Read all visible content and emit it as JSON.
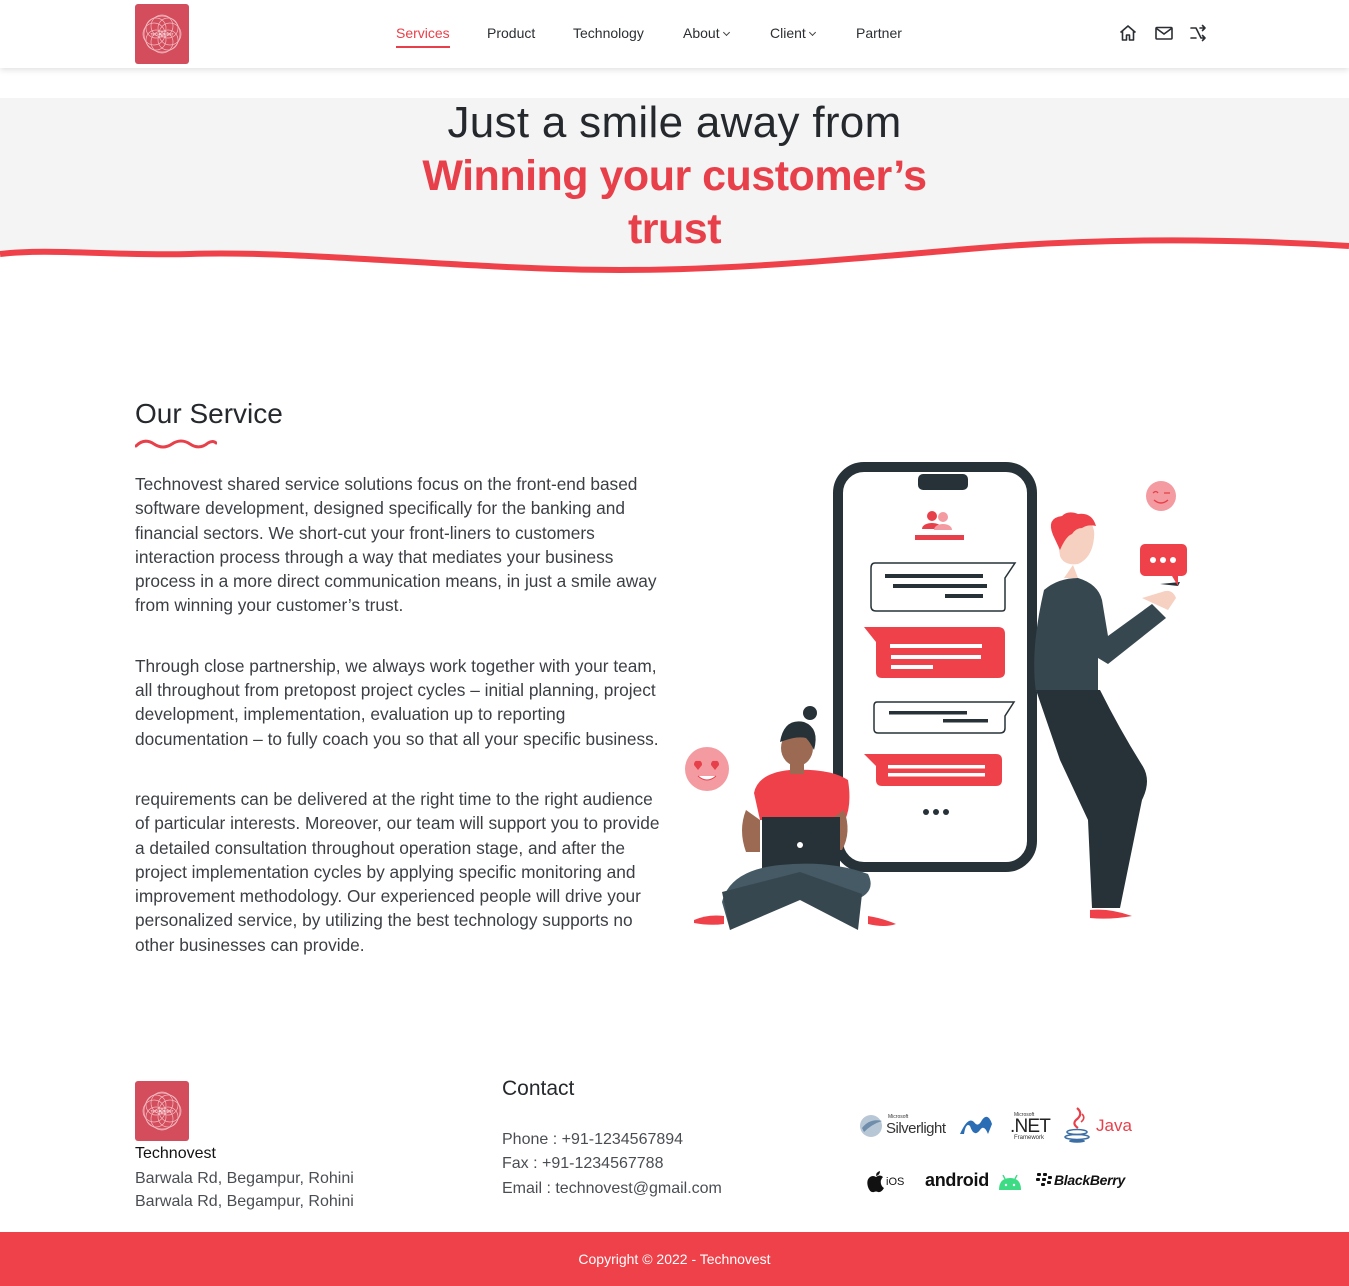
{
  "brand": {
    "logo_text": "TECHNOVEST",
    "name": "Technovest"
  },
  "nav": {
    "items": [
      {
        "label": "Services",
        "active": true
      },
      {
        "label": "Product"
      },
      {
        "label": "Technology"
      },
      {
        "label": "About",
        "dropdown": true
      },
      {
        "label": "Client",
        "dropdown": true
      },
      {
        "label": "Partner"
      }
    ],
    "icons": [
      "home-icon",
      "mail-icon",
      "shuffle-icon"
    ]
  },
  "hero": {
    "line1": "Just a smile away from",
    "line2a": "Winning your customer’s",
    "line2b": "trust"
  },
  "service": {
    "title": "Our Service",
    "paragraphs": [
      "Technovest shared service solutions focus on the front-end based software development, designed specifically for the banking and financial sectors. We short-cut your front-liners to customers interaction process through a way that mediates your business process in a more direct communication means, in just a smile away from winning your customer’s trust.",
      "Through close partnership, we always work together with your team, all throughout from pretopost project cycles – initial planning, project development, implementation, evaluation up to reporting documentation – to fully coach you so that all your specific business.",
      "requirements can be delivered at the right time to the right audience of particular interests. Moreover, our team will support you to provide a detailed consultation throughout operation stage, and after the project implementation cycles by applying specific monitoring and improvement methodology. Our experienced people will drive your personalized service, by utilizing the best technology supports no other businesses can provide."
    ]
  },
  "footer": {
    "brand": "Technovest",
    "address1": "Barwala Rd, Begampur, Rohini",
    "address2": "Barwala Rd, Begampur, Rohini",
    "contact_title": "Contact",
    "phone": "Phone : +91-1234567894",
    "fax": "Fax : +91-1234567788",
    "email": "Email : technovest@gmail.com",
    "technologies": {
      "silverlight_small": "Microsoft",
      "silverlight": "Silverlight",
      "net_small": "Microsoft",
      "net": ".NET",
      "net_sub": "Framework",
      "java": "Java",
      "ios": "iOS",
      "android": "android",
      "blackberry": "BlackBerry"
    },
    "copyright": "Copyright © 2022 - Technovest"
  },
  "colors": {
    "accent": "#e8404a",
    "footer_bar": "#ef4149",
    "hero_bg": "#f4f4f4",
    "logo_bg": "#d34d5c"
  }
}
